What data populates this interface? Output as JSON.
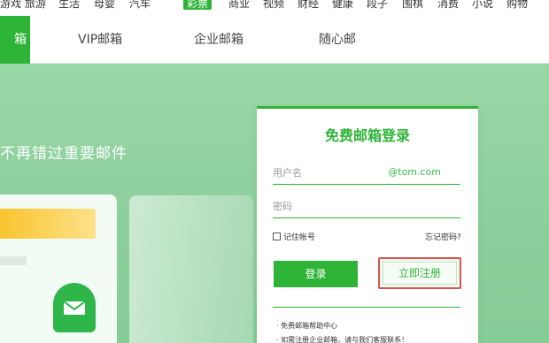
{
  "top_nav": [
    "游戏",
    "旅游",
    "生活",
    "母婴",
    "汽车",
    "彩票",
    "商业",
    "视频",
    "财经",
    "健康",
    "段子",
    "围棋",
    "消费",
    "小说",
    "购物"
  ],
  "top_nav_active_index": 5,
  "tab_bar": {
    "brand_fragment": "箱",
    "tabs": [
      "VIP邮箱",
      "企业邮箱",
      "随心邮"
    ]
  },
  "hero": {
    "slogan": "不再错过重要邮件"
  },
  "login": {
    "title": "免费邮箱登录",
    "username_placeholder": "用户名",
    "domain_suffix": "@tom.com",
    "password_placeholder": "密码",
    "remember_label": "记住帐号",
    "forgot_label": "忘记密码?",
    "login_button": "登录",
    "register_button": "立即注册",
    "help": [
      "· 免费邮箱帮助中心",
      "· 如需注册企业邮箱，请与我们客服联系！"
    ]
  },
  "colors": {
    "brand_green": "#2db437",
    "hero_bg": "#8ed19e",
    "register_highlight": "#d9534f"
  },
  "icons": {
    "mail_badge": "envelope-icon"
  }
}
